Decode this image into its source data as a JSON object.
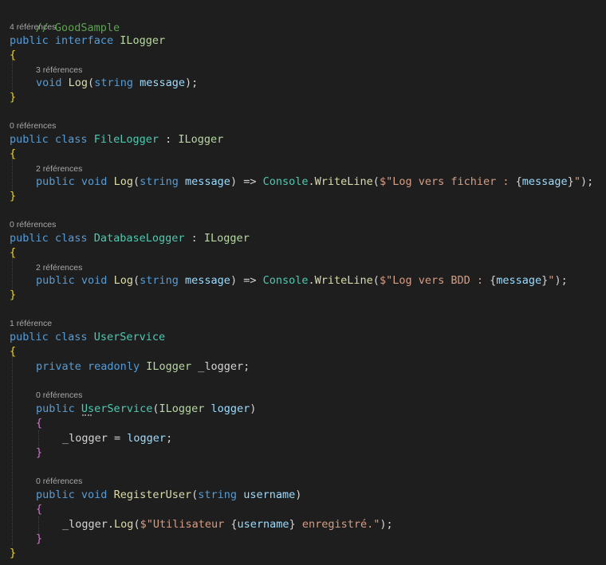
{
  "colors": {
    "background": "#1e1e1e",
    "keyword": "#569cd6",
    "type": "#4ec9b0",
    "interface": "#b8d7a3",
    "method": "#dcdcaa",
    "parameter": "#9cdcfe",
    "string": "#d69d85",
    "comment": "#57a64a",
    "punctuation": "#d4d4d4",
    "brace": "#f0d70e",
    "codelens": "#a8a8a8"
  },
  "code": {
    "comment": "// GoodSample",
    "ilogger": {
      "refs": "4 références",
      "kw_public": "public",
      "kw_interface": "interface",
      "name": "ILogger",
      "open": "{",
      "method_refs": "3 références",
      "kw_void": "void",
      "method": "Log",
      "paren_open": "(",
      "kw_string": "string",
      "param": "message",
      "end": ");",
      "close": "}"
    },
    "file_logger": {
      "refs": "0 références",
      "kw_public": "public",
      "kw_class": "class",
      "name": "FileLogger",
      "colon": ":",
      "base": "ILogger",
      "open": "{",
      "method_refs": "2 références",
      "kw_public2": "public",
      "kw_void": "void",
      "method": "Log",
      "paren_open": "(",
      "kw_string": "string",
      "param": "message",
      "paren_close_arrow": ") =>",
      "console": "Console",
      "dot": ".",
      "writeline": "WriteLine",
      "paren2": "(",
      "str_start": "$\"Log vers fichier : ",
      "interp_open": "{",
      "interp_var": "message",
      "interp_close": "}",
      "str_end": "\"",
      "end": ");",
      "close": "}"
    },
    "database_logger": {
      "refs": "0 références",
      "kw_public": "public",
      "kw_class": "class",
      "name": "DatabaseLogger",
      "colon": ":",
      "base": "ILogger",
      "open": "{",
      "method_refs": "2 références",
      "kw_public2": "public",
      "kw_void": "void",
      "method": "Log",
      "paren_open": "(",
      "kw_string": "string",
      "param": "message",
      "paren_close_arrow": ") =>",
      "console": "Console",
      "dot": ".",
      "writeline": "WriteLine",
      "paren2": "(",
      "str_start": "$\"Log vers BDD : ",
      "interp_open": "{",
      "interp_var": "message",
      "interp_close": "}",
      "str_end": "\"",
      "end": ");",
      "close": "}"
    },
    "user_service": {
      "refs": "1 référence",
      "kw_public": "public",
      "kw_class": "class",
      "name": "UserService",
      "open": "{",
      "field": {
        "kw_private": "private",
        "kw_readonly": "readonly",
        "type": "ILogger",
        "name": "_logger;"
      },
      "ctor": {
        "refs": "0 références",
        "kw_public": "public",
        "name": "UserService",
        "paren_open": "(",
        "type": "ILogger",
        "param": "logger",
        "paren_close": ")",
        "open": "{",
        "lhs": "_logger",
        "assign": " = ",
        "rhs": "logger",
        "semi": ";",
        "close": "}"
      },
      "register": {
        "refs": "0 références",
        "kw_public": "public",
        "kw_void": "void",
        "name": "RegisterUser",
        "paren_open": "(",
        "kw_string": "string",
        "param": "username",
        "paren_close": ")",
        "open": "{",
        "target": "_logger",
        "dot": ".",
        "method": "Log",
        "paren2": "(",
        "str_start": "$\"Utilisateur ",
        "interp_open": "{",
        "interp_var": "username",
        "interp_close": "}",
        "str_end": " enregistré.\"",
        "end": ");",
        "close": "}"
      },
      "close": "}"
    }
  }
}
